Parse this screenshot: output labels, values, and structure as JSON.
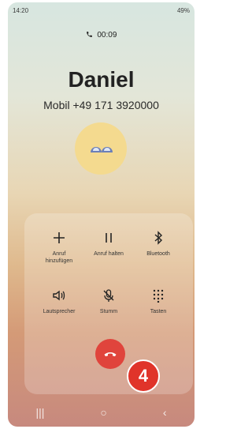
{
  "status": {
    "time": "14:20",
    "battery": "49%"
  },
  "call": {
    "duration": "00:09",
    "name": "Daniel",
    "number": "Mobil +49 171 3920000"
  },
  "controls": [
    {
      "label": "Anruf\nhinzufügen",
      "icon": "plus-icon"
    },
    {
      "label": "Anruf halten",
      "icon": "pause-icon"
    },
    {
      "label": "Bluetooth",
      "icon": "bluetooth-icon"
    },
    {
      "label": "Lautsprecher",
      "icon": "speaker-icon"
    },
    {
      "label": "Stumm",
      "icon": "mic-off-icon"
    },
    {
      "label": "Tasten",
      "icon": "keypad-icon"
    }
  ],
  "badge": "4",
  "colors": {
    "end_call": "#e0443c",
    "badge": "#e0342a",
    "avatar": "#f4da8f"
  }
}
